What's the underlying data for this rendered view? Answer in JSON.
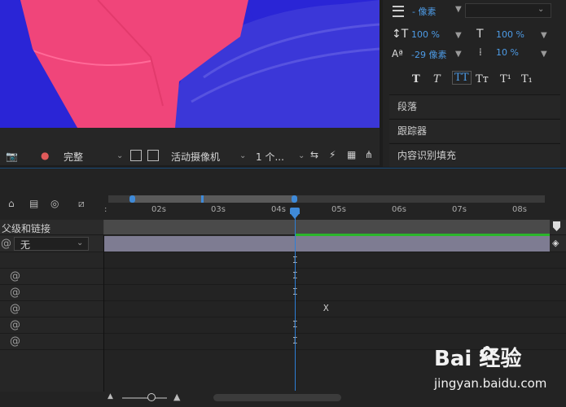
{
  "viewer": {
    "quality": "完整",
    "camera": "活动摄像机",
    "views": "1 个..."
  },
  "character_panel": {
    "leading": "- 像素",
    "vert_scale": "100 %",
    "horiz_scale": "100 %",
    "baseline_shift": "-29 像素",
    "tsume": "10 %",
    "styles": [
      "T",
      "T",
      "TT",
      "Tт",
      "T¹",
      "T₁"
    ]
  },
  "panels": [
    "段落",
    "跟踪器",
    "内容识别填充"
  ],
  "timeline": {
    "parent_header": "父级和链接",
    "parent_value": "无",
    "ruler_ticks": [
      ":",
      "02s",
      "03s",
      "04s",
      "05s",
      "06s",
      "07s",
      "08s"
    ]
  },
  "watermark": {
    "brand": "Bai 经验",
    "url": "jingyan.baidu.com"
  }
}
